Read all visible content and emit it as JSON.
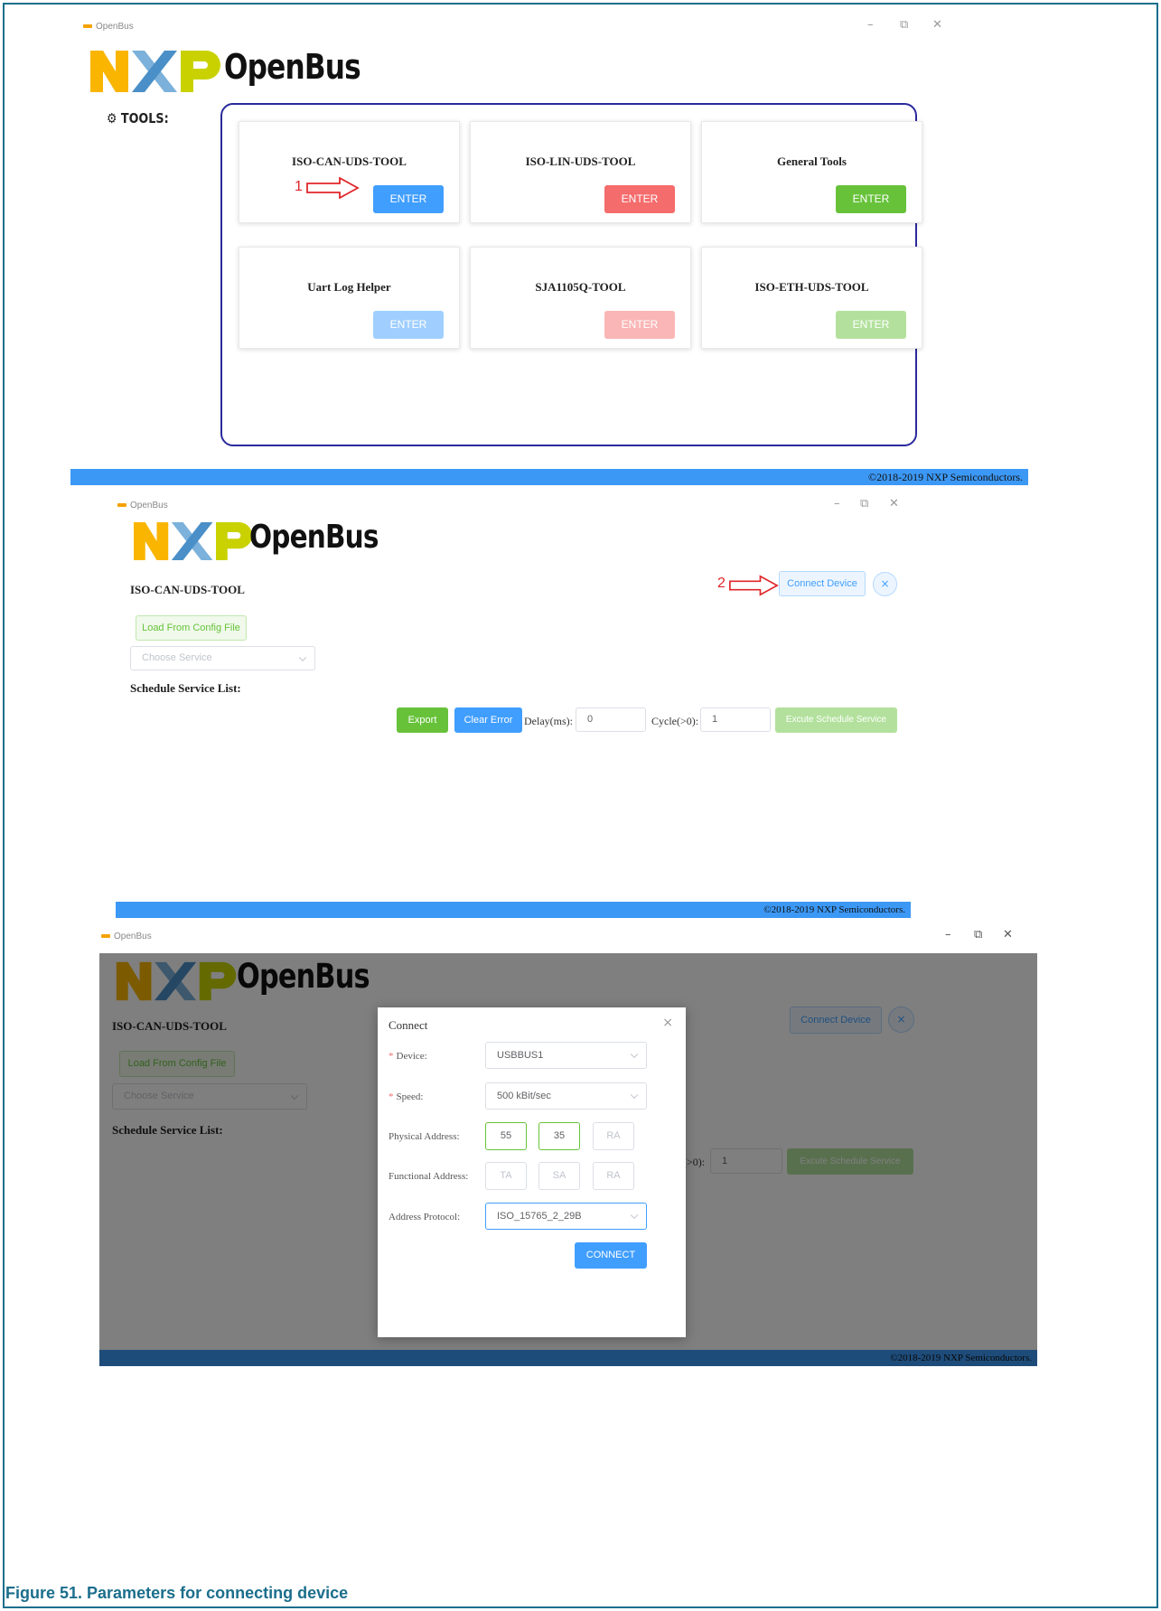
{
  "window": {
    "title": "OpenBus",
    "minimize": "–",
    "restore": "⧉",
    "close": "✕"
  },
  "brand": {
    "name": "OpenBus"
  },
  "tools_heading": "TOOLS:",
  "tools": [
    {
      "name": "ISO-CAN-UDS-TOOL",
      "button": "ENTER",
      "color": "#409eff",
      "enabled": true
    },
    {
      "name": "ISO-LIN-UDS-TOOL",
      "button": "ENTER",
      "color": "#f56c6c",
      "enabled": true
    },
    {
      "name": "General Tools",
      "button": "ENTER",
      "color": "#67c23a",
      "enabled": true
    },
    {
      "name": "Uart Log Helper",
      "button": "ENTER",
      "color": "#a0cfff",
      "enabled": false
    },
    {
      "name": "SJA1105Q-TOOL",
      "button": "ENTER",
      "color": "#fab6b6",
      "enabled": false
    },
    {
      "name": "ISO-ETH-UDS-TOOL",
      "button": "ENTER",
      "color": "#b3e19d",
      "enabled": false
    }
  ],
  "annotations": {
    "step1": "1",
    "step2": "2"
  },
  "footer": "©2018-2019 NXP Semiconductors.",
  "can_tool": {
    "title": "ISO-CAN-UDS-TOOL",
    "connect_button": "Connect Device",
    "close_icon": "×",
    "load_config_button": "Load From Config File",
    "service_placeholder": "Choose Service",
    "schedule_heading": "Schedule Service List:",
    "export_button": "Export",
    "clear_error_button": "Clear Error",
    "delay_label": "Delay(ms):",
    "delay_value": "0",
    "cycle_label": "Cycle(>0):",
    "cycle_value": "1",
    "execute_button": "Excute Schedule Service"
  },
  "connect_dialog": {
    "title": "Connect",
    "close_icon": "×",
    "device_label": "Device:",
    "device_value": "USBBUS1",
    "speed_label": "Speed:",
    "speed_value": "500 kBit/sec",
    "required_mark": "*",
    "physical_label": "Physical Address:",
    "physical_values": [
      "55",
      "35",
      "RA"
    ],
    "functional_label": "Functional Address:",
    "functional_values": [
      "TA",
      "SA",
      "RA"
    ],
    "protocol_label": "Address Protocol:",
    "protocol_value": "ISO_15765_2_29B",
    "connect_button": "CONNECT"
  },
  "caption": "Figure 51.  Parameters for connecting device"
}
